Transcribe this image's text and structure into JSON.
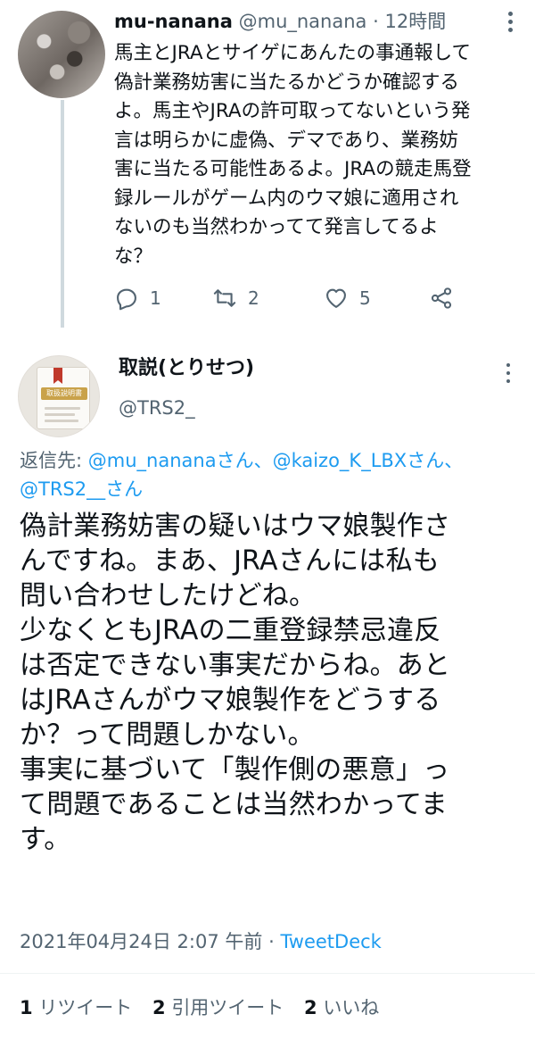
{
  "parent_tweet": {
    "author_name": "mu-nanana",
    "handle": "@mu_nanana",
    "separator": "·",
    "time": "12時間",
    "text": "馬主とJRAとサイゲにあんたの事通報して\n偽計業務妨害に当たるかどうか確認する\nよ。馬主やJRAの許可取ってないという発\n言は明らかに虚偽、デマであり、業務妨\n害に当たる可能性あるよ。JRAの競走馬登\n録ルールがゲーム内のウマ娘に適用され\nないのも当然わかってて発言してるよ\nな？",
    "actions": {
      "reply_count": "1",
      "retweet_count": "2",
      "like_count": "5"
    }
  },
  "main_tweet": {
    "author_name": "取説(とりせつ)",
    "handle": "@TRS2_",
    "avatar_label": "取扱説明書",
    "replying_to": {
      "prefix": "返信先: ",
      "mentions": "@mu_nananaさん、@kaizo_K_LBXさん、\n@TRS2__さん"
    },
    "text": "偽計業務妨害の疑いはウマ娘製作さ\nんですね。まあ、JRAさんには私も\n問い合わせしたけどね。\n少なくともJRAの二重登録禁忌違反\nは否定できない事実だからね。あと\nはJRAさんがウマ娘製作をどうする\nか？って問題しかない。\n事実に基づいて「製作側の悪意」っ\nて問題であることは当然わかってま\nす。",
    "timestamp": "2021年04月24日 2:07 午前",
    "separator": " · ",
    "source": "TweetDeck",
    "stats": {
      "retweets_count": "1",
      "retweets_label": "リツイート",
      "quotes_count": "2",
      "quotes_label": "引用ツイート",
      "likes_count": "2",
      "likes_label": "いいね"
    }
  },
  "colors": {
    "text_primary": "#0f1419",
    "text_secondary": "#536471",
    "link": "#1d9bf0",
    "divider": "#eff3f4",
    "thread_line": "#cfd9de"
  }
}
